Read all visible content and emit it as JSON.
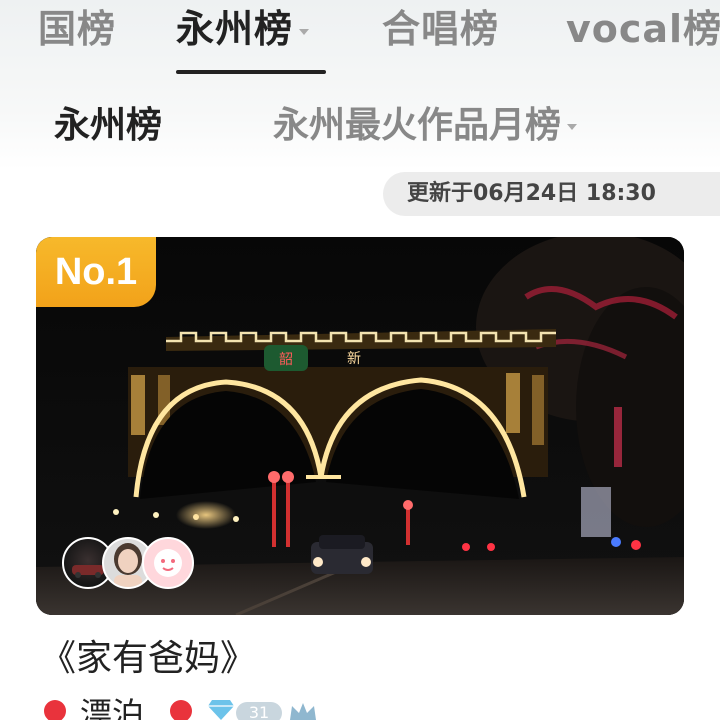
{
  "top_tabs": [
    {
      "label": "国榜"
    },
    {
      "label": "永州榜"
    },
    {
      "label": "合唱榜"
    },
    {
      "label": "vocal榜"
    }
  ],
  "sub_tabs": [
    {
      "label": "永州榜"
    },
    {
      "label": "永州最火作品月榜"
    }
  ],
  "update_time": "更新于06月24日 18:30",
  "card": {
    "rank_badge": "No.1",
    "title": "《家有爸妈》",
    "artist": "漂泊",
    "level": "31"
  },
  "colors": {
    "badge": "#f4ac20",
    "active_text": "#222222",
    "inactive_text": "#888888",
    "pin": "#e9333c"
  }
}
